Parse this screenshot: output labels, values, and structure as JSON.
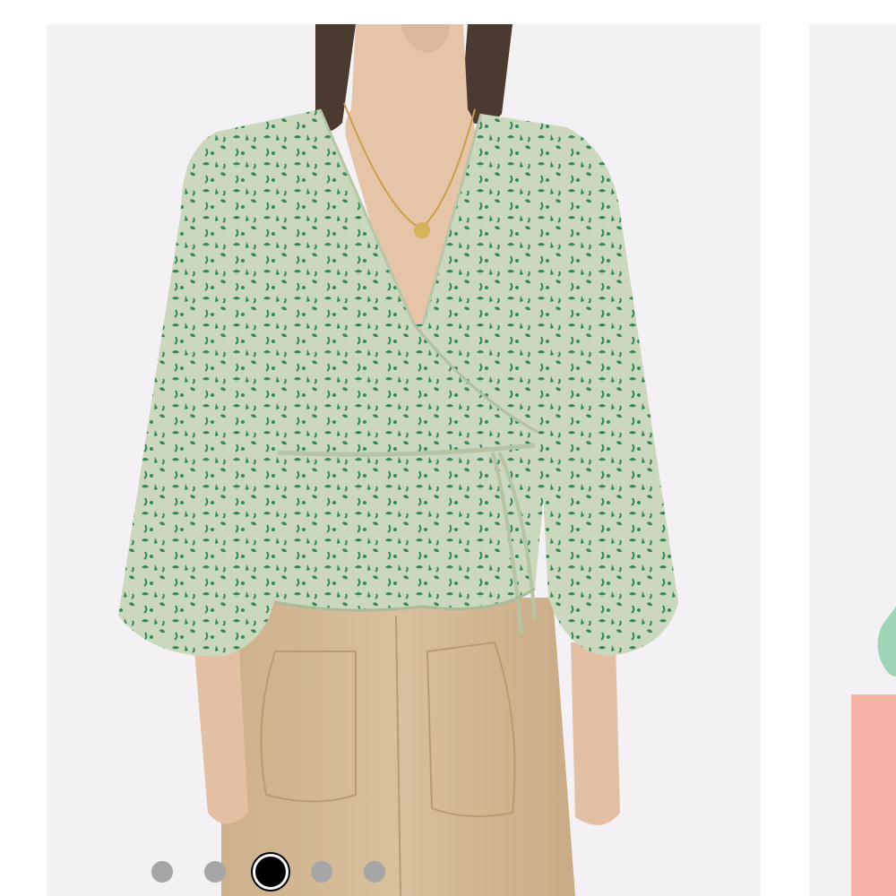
{
  "carousel": {
    "slide_count": 5,
    "active_index": 2,
    "slides": [
      {
        "label": "product-image-1"
      },
      {
        "label": "product-image-2"
      },
      {
        "label": "product-image-3"
      },
      {
        "label": "product-image-4"
      },
      {
        "label": "product-image-5"
      }
    ]
  },
  "colors": {
    "slide_background": "#f3f1f3",
    "blouse_base": "#c9d7bc",
    "blouse_print": "#2e8a58",
    "pants": "#d4b896",
    "skin": "#e6c4a8",
    "hair": "#4a3a30",
    "dot_inactive": "#a6a5a7",
    "dot_active": "#000000",
    "peach_card": "#f4b3a4"
  }
}
